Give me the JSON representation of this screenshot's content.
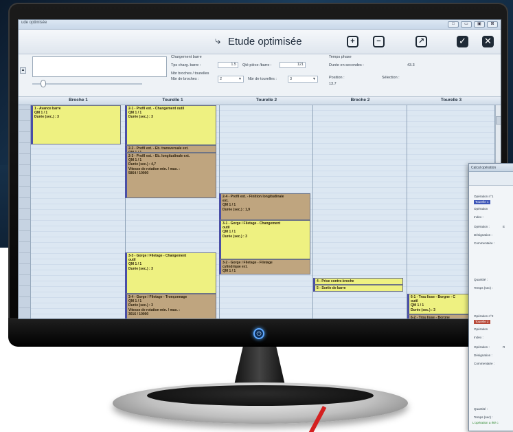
{
  "window": {
    "title": "ude optimisée",
    "buttons": [
      "□",
      "▭",
      "▣",
      "⊠"
    ]
  },
  "toolbar": {
    "title": "Etude optimisée",
    "title_icon": "arrow-step-icon",
    "zoom_in": "+",
    "zoom_out": "−",
    "chart_icon": "↗",
    "validate": "✓",
    "close": "✕"
  },
  "params": {
    "chargement_barre": "Chargement barre",
    "tps_charg_label": "Tps charg. barre :",
    "tps_charg_value": "1.5",
    "qte_piece_label": "Qté pièce /barre :",
    "qte_piece_value": "121",
    "nbr_broches_tourelles": "Nbr broches / tourelles",
    "nbr_broches_label": "Nbr de broches :",
    "nbr_broches_value": "2",
    "nbr_tourelles_label": "Nbr de tourelles :",
    "nbr_tourelles_value": "3",
    "temps_phase": "Temps phase",
    "duree_label": "Durée en secondes :",
    "duree_value": "43.3",
    "position_label": "Position :",
    "position_value": "13.7",
    "selection_label": "Sélection :"
  },
  "gantt": {
    "columns": [
      "Broche 1",
      "Tourelle 1",
      "Tourelle 2",
      "Broche 2",
      "Tourelle 3"
    ],
    "operations": [
      {
        "lines": [
          "1 - Avance barre",
          "QM  1 / 1",
          "Durée (sec.) : 3"
        ]
      },
      {
        "lines": [
          "2-1 - Profil ext. - Changement outil",
          "QM  1 / 1",
          "Durée (sec.) : 3"
        ]
      },
      {
        "lines": [
          "2-2 - Profil ext. - Eb. transversale ext.",
          "QM  1 / 1"
        ]
      },
      {
        "lines": [
          "2-3 - Profil ext. - Eb. longitudinale ext.",
          "QM  1 / 1",
          "Durée (sec.) : 4,7",
          "Vitesse de rotation min. / max. :",
          "5864 / 10000"
        ]
      },
      {
        "lines": [
          "2-4 - Profil ext. - Finition longitudinale",
          "ext.",
          "QM  1 / 1",
          "Durée (sec.) : 1,9"
        ]
      },
      {
        "lines": [
          "3-1 - Gorge / Filetage - Changement",
          "outil",
          "QM  1 / 1",
          "Durée (sec.) : 3"
        ]
      },
      {
        "lines": [
          "3-3 - Gorge / Filetage - Changement",
          "outil",
          "QM  1 / 1",
          "Durée (sec.) : 3"
        ]
      },
      {
        "lines": [
          "3-2 - Gorge / Filetage - Filetage",
          "cylindrique ext.",
          "QM  1 / 1"
        ]
      },
      {
        "lines": [
          "4 - Prise contre-broche"
        ]
      },
      {
        "lines": [
          "5 - Sortie de barre"
        ]
      },
      {
        "lines": [
          "3-4 - Gorge / Filetage - Tronçonnage",
          "QM  1 / 1",
          "Durée (sec.) : 3",
          "Vitesse de rotation min. / max. :",
          "3016 / 10000"
        ]
      },
      {
        "lines": [
          "6-1 - Trou lisse - Borgne - C",
          "outil",
          "QM  1 / 1",
          "Durée (sec.) : 3"
        ]
      },
      {
        "lines": [
          "6-2 - Trou lisse - Borgne"
        ]
      }
    ]
  },
  "popup": {
    "title": "Calcul opération",
    "op1": "Opération n°1",
    "op1_badge": "Tourelle 1",
    "op2": "Opération n°2",
    "op2_badge": "Tourelle 2",
    "operation": "Opération",
    "index": "Index :",
    "operation2": "Opération :",
    "op1_value": "E",
    "op2_value": "R",
    "designation": "Désignation :",
    "commentaire": "Commentaire :",
    "quantite": "Quantité :",
    "temps": "Temps (sec) :",
    "status": "L'opération a été c"
  }
}
